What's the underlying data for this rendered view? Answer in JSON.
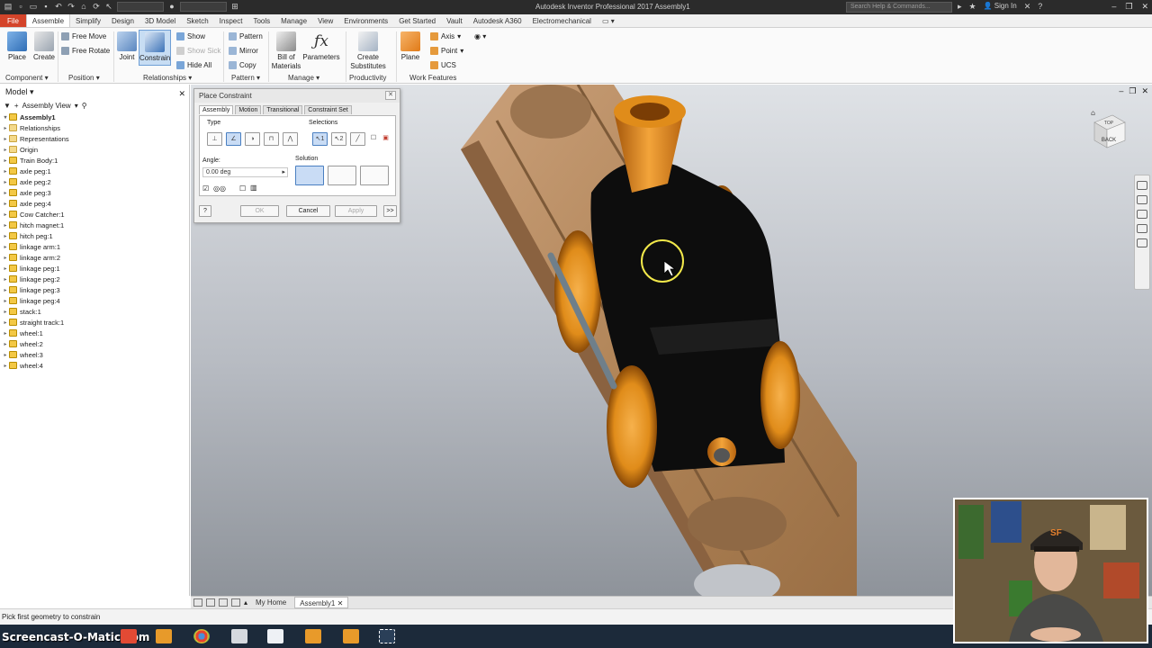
{
  "title_bar": {
    "app_title": "Autodesk Inventor Professional 2017    Assembly1",
    "search_placeholder": "Search Help & Commands...",
    "sign_in": "Sign In"
  },
  "menu_tabs": [
    "File",
    "Assemble",
    "Simplify",
    "Design",
    "3D Model",
    "Sketch",
    "Inspect",
    "Tools",
    "Manage",
    "View",
    "Environments",
    "Get Started",
    "Vault",
    "Autodesk A360",
    "Electromechanical"
  ],
  "active_tab": "Assemble",
  "ribbon": {
    "place": "Place",
    "create": "Create",
    "component_panel": "Component",
    "free_move": "Free Move",
    "free_rotate": "Free Rotate",
    "position_panel": "Position",
    "joint": "Joint",
    "constrain": "Constrain",
    "show": "Show",
    "show_sick": "Show Sick",
    "hide_all": "Hide All",
    "relationships_panel": "Relationships",
    "pattern": "Pattern",
    "mirror": "Mirror",
    "copy": "Copy",
    "pattern_panel": "Pattern",
    "bill_of_materials": "Bill of Materials",
    "parameters": "Parameters",
    "manage_panel": "Manage",
    "create_substitutes": "Create Substitutes",
    "productivity_panel": "Productivity",
    "plane": "Plane",
    "axis": "Axis",
    "point": "Point",
    "ucs": "UCS",
    "work_features_panel": "Work Features"
  },
  "browser": {
    "header": "Model",
    "view": "Assembly View",
    "root": "Assembly1",
    "items": [
      "Relationships",
      "Representations",
      "Origin",
      "Train Body:1",
      "axle peg:1",
      "axle peg:2",
      "axle peg:3",
      "axle peg:4",
      "Cow Catcher:1",
      "hitch magnet:1",
      "hitch peg:1",
      "linkage arm:1",
      "linkage arm:2",
      "linkage peg:1",
      "linkage peg:2",
      "linkage peg:3",
      "linkage peg:4",
      "stack:1",
      "straight track:1",
      "wheel:1",
      "wheel:2",
      "wheel:3",
      "wheel:4"
    ]
  },
  "dialog": {
    "title": "Place Constraint",
    "tabs": [
      "Assembly",
      "Motion",
      "Transitional",
      "Constraint Set"
    ],
    "type_label": "Type",
    "selections_label": "Selections",
    "angle_label": "Angle:",
    "angle_value": "0.00 deg",
    "solution_label": "Solution",
    "ok": "OK",
    "cancel": "Cancel",
    "apply": "Apply",
    "more": ">>",
    "help": "?"
  },
  "viewcube": {
    "top": "TOP",
    "back": "BACK"
  },
  "doc_tabs": {
    "home": "My Home",
    "active": "Assembly1"
  },
  "status": "Pick first geometry to constrain",
  "watermark": "Screencast-O-Matic.com",
  "colors": {
    "file_tab": "#d4442a",
    "wood": "#b08457",
    "brass": "#e08c1a",
    "body": "#0d0d0d"
  }
}
